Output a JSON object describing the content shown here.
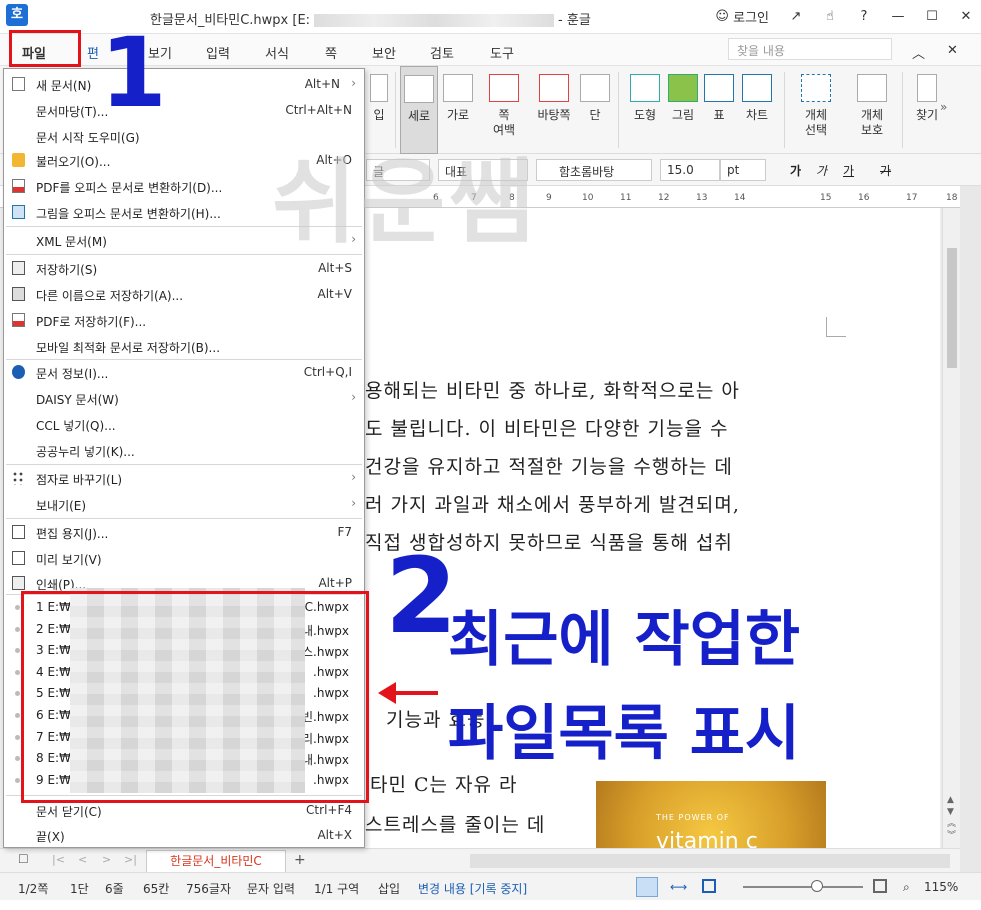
{
  "title_bar": {
    "app_icon": "호",
    "title_prefix": "한글문서_비타민C.hwpx [E:",
    "title_suffix": "- 훈글",
    "login": "로그인",
    "buttons": [
      "↗",
      "☝",
      "?",
      "—",
      "☐",
      "✕"
    ]
  },
  "menu": {
    "items": [
      "파일",
      "편",
      "보기",
      "입력",
      "서식",
      "쪽",
      "보안",
      "검토",
      "도구"
    ],
    "search_placeholder": "찾을 내용"
  },
  "ribbon": {
    "partial_left": "입",
    "items": [
      {
        "label": "세로",
        "label2": ""
      },
      {
        "label": "가로",
        "label2": ""
      },
      {
        "label": "쪽",
        "label2": "여백"
      },
      {
        "label": "바탕쪽",
        "label2": ""
      },
      {
        "label": "단",
        "label2": ""
      },
      {
        "label": "도형",
        "label2": ""
      },
      {
        "label": "그림",
        "label2": ""
      },
      {
        "label": "표",
        "label2": ""
      },
      {
        "label": "차트",
        "label2": ""
      },
      {
        "label": "개체",
        "label2": "선택"
      },
      {
        "label": "개체",
        "label2": "보호"
      },
      {
        "label": "찾기",
        "label2": ""
      }
    ]
  },
  "format_bar": {
    "lang": "글",
    "style": "대표",
    "font": "함초롬바탕",
    "size": "15.0",
    "unit": "pt",
    "char_buttons": [
      "가",
      "가",
      "가",
      "가"
    ]
  },
  "ruler": {
    "ticks": [
      "6",
      "7",
      "8",
      "9",
      "10",
      "11",
      "12",
      "13",
      "14",
      "15",
      "16",
      "17",
      "18"
    ]
  },
  "file_menu": {
    "items": [
      {
        "label": "새 문서(N)",
        "shortcut": "Alt+N",
        "arrow": "›",
        "icon": "new-document-icon"
      },
      {
        "label": "문서마당(T)...",
        "shortcut": "Ctrl+Alt+N",
        "arrow": "",
        "icon": ""
      },
      {
        "label": "문서 시작 도우미(G)",
        "shortcut": "",
        "arrow": "",
        "icon": ""
      },
      {
        "label": "불러오기(O)...",
        "shortcut": "Alt+O",
        "arrow": "",
        "icon": "open-folder-icon"
      },
      {
        "label": "PDF를 오피스 문서로 변환하기(D)...",
        "shortcut": "",
        "arrow": "",
        "icon": "pdf-convert-icon"
      },
      {
        "label": "그림을 오피스 문서로 변환하기(H)...",
        "shortcut": "",
        "arrow": "",
        "icon": "image-convert-icon"
      },
      {
        "label": "XML 문서(M)",
        "shortcut": "",
        "arrow": "›",
        "icon": ""
      },
      {
        "label": "저장하기(S)",
        "shortcut": "Alt+S",
        "arrow": "",
        "icon": "save-icon"
      },
      {
        "label": "다른 이름으로 저장하기(A)...",
        "shortcut": "Alt+V",
        "arrow": "",
        "icon": "save-as-icon"
      },
      {
        "label": "PDF로 저장하기(F)...",
        "shortcut": "",
        "arrow": "",
        "icon": "pdf-save-icon"
      },
      {
        "label": "모바일 최적화 문서로 저장하기(B)...",
        "shortcut": "",
        "arrow": "",
        "icon": ""
      },
      {
        "label": "문서 정보(I)...",
        "shortcut": "Ctrl+Q,I",
        "arrow": "",
        "icon": "info-icon"
      },
      {
        "label": "DAISY 문서(W)",
        "shortcut": "",
        "arrow": "›",
        "icon": ""
      },
      {
        "label": "CCL 넣기(Q)...",
        "shortcut": "",
        "arrow": "",
        "icon": ""
      },
      {
        "label": "공공누리 넣기(K)...",
        "shortcut": "",
        "arrow": "",
        "icon": ""
      },
      {
        "label": "점자로 바꾸기(L)",
        "shortcut": "",
        "arrow": "›",
        "icon": "braille-icon"
      },
      {
        "label": "보내기(E)",
        "shortcut": "",
        "arrow": "›",
        "icon": ""
      },
      {
        "label": "편집 용지(J)...",
        "shortcut": "F7",
        "arrow": "",
        "icon": "page-setup-icon"
      },
      {
        "label": "미리 보기(V)",
        "shortcut": "",
        "arrow": "",
        "icon": "preview-icon"
      },
      {
        "label": "인쇄(P)...",
        "shortcut": "Alt+P",
        "arrow": "",
        "icon": "print-icon"
      }
    ],
    "recent": [
      {
        "label": "1 E:₩",
        "suffix": "C.hwpx"
      },
      {
        "label": "2 E:₩",
        "suffix": "내.hwpx"
      },
      {
        "label": "3 E:₩",
        "suffix": "스.hwpx"
      },
      {
        "label": "4 E:₩",
        "suffix": ".hwpx"
      },
      {
        "label": "5 E:₩",
        "suffix": ".hwpx"
      },
      {
        "label": "6 E:₩",
        "suffix": "빈.hwpx"
      },
      {
        "label": "7 E:₩",
        "suffix": "리.hwpx"
      },
      {
        "label": "8 E:₩",
        "suffix": "내.hwpx"
      },
      {
        "label": "9 E:₩",
        "suffix": ".hwpx"
      }
    ],
    "bottom": [
      {
        "label": "문서 닫기(C)",
        "shortcut": "Ctrl+F4"
      },
      {
        "label": "끝(X)",
        "shortcut": "Alt+X"
      }
    ]
  },
  "document": {
    "lines": [
      "용해되는 비타민 중 하나로, 화학적으로는 아",
      "도 불립니다. 이 비타민은 다양한 기능을 수",
      "건강을 유지하고 적절한 기능을 수행하는 데",
      "러 가지 과일과 채소에서 풍부하게 발견되며,",
      "직접 생합성하지 못하므로 식품을 통해 섭취",
      "기능과 효능",
      "타민 C는 자유 라",
      "스트레스를 줄이는 데"
    ],
    "image_text_small": "THE POWER OF",
    "image_text_big": "vitamin c"
  },
  "tabs": {
    "doc_tab": "한글문서_비타민C",
    "add": "+",
    "nav": [
      "|<",
      "<",
      ">",
      ">|"
    ]
  },
  "status": {
    "page": "1/2쪽",
    "column": "1단",
    "line": "6줄",
    "col_pos": "65칸",
    "chars": "756글자",
    "mode": "문자 입력",
    "section": "1/1 구역",
    "insert": "삽입",
    "track": "변경 내용 [기록 중지]",
    "zoom": "115%"
  },
  "annotations": {
    "num1": "1",
    "num2": "2",
    "line1": "최근에 작업한",
    "line2": "파일목록 표시",
    "watermark": "쉬운쌤"
  },
  "colors": {
    "annotation_red": "#e3131b",
    "annotation_blue": "#1620c8",
    "tab_text": "#d9341a"
  }
}
